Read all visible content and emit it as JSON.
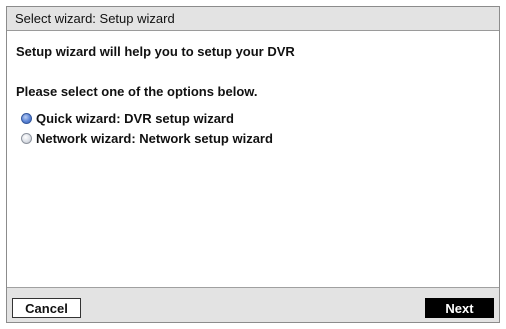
{
  "dialog": {
    "title": "Select wizard: Setup wizard",
    "intro_text": "Setup wizard will help you to setup your DVR",
    "prompt_text": "Please select one of the options below.",
    "options": [
      {
        "label": "Quick wizard: DVR setup wizard",
        "selected": true
      },
      {
        "label": "Network wizard: Network setup wizard",
        "selected": false
      }
    ]
  },
  "footer": {
    "cancel_label": "Cancel",
    "next_label": "Next"
  },
  "colors": {
    "title_bar_bg": "#e3e3e3",
    "radio_selected": "#5b84d6",
    "next_button_bg": "#000000"
  }
}
